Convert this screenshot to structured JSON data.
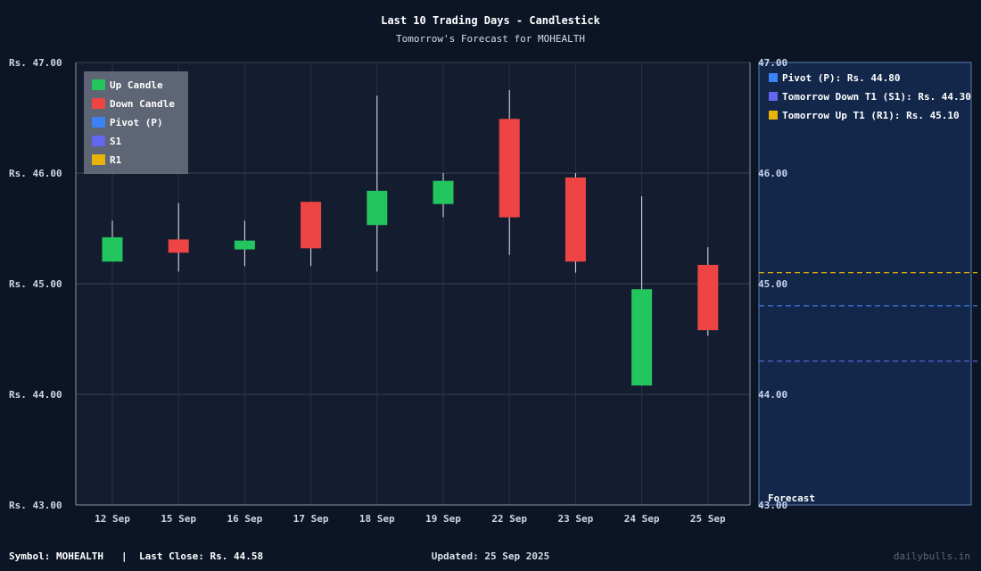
{
  "chart_data": {
    "type": "candlestick",
    "title": "Last 10 Trading Days - Candlestick",
    "subtitle": "Tomorrow's Forecast for MOHEALTH",
    "ylim": [
      43,
      47
    ],
    "y_ticks": [
      "Rs. 47.00",
      "Rs. 46.00",
      "Rs. 45.00",
      "Rs. 44.00",
      "Rs. 43.00"
    ],
    "right_ticks": [
      "47.00",
      "46.00",
      "45.00",
      "44.00",
      "43.00"
    ],
    "y_tick_values": [
      47,
      46,
      45,
      44,
      43
    ],
    "grid": true,
    "categories": [
      "12 Sep",
      "15 Sep",
      "16 Sep",
      "17 Sep",
      "18 Sep",
      "19 Sep",
      "22 Sep",
      "23 Sep",
      "24 Sep",
      "25 Sep"
    ],
    "candles": [
      {
        "date": "12 Sep",
        "open": 45.2,
        "close": 45.42,
        "high": 45.57,
        "low": 45.2
      },
      {
        "date": "15 Sep",
        "open": 45.4,
        "close": 45.28,
        "high": 45.73,
        "low": 45.11
      },
      {
        "date": "16 Sep",
        "open": 45.31,
        "close": 45.39,
        "high": 45.57,
        "low": 45.16
      },
      {
        "date": "17 Sep",
        "open": 45.74,
        "close": 45.32,
        "high": 45.74,
        "low": 45.16
      },
      {
        "date": "18 Sep",
        "open": 45.53,
        "close": 45.84,
        "high": 46.7,
        "low": 45.11
      },
      {
        "date": "19 Sep",
        "open": 45.72,
        "close": 45.93,
        "high": 46.0,
        "low": 45.6
      },
      {
        "date": "22 Sep",
        "open": 46.49,
        "close": 45.6,
        "high": 46.75,
        "low": 45.26
      },
      {
        "date": "23 Sep",
        "open": 45.96,
        "close": 45.2,
        "high": 46.0,
        "low": 45.1
      },
      {
        "date": "24 Sep",
        "open": 44.08,
        "close": 44.95,
        "high": 45.79,
        "low": 44.08
      },
      {
        "date": "25 Sep",
        "open": 45.17,
        "close": 44.58,
        "high": 45.33,
        "low": 44.53
      }
    ],
    "legend": [
      "Up Candle",
      "Down Candle",
      "Pivot (P)",
      "S1",
      "R1"
    ],
    "legend_placement": "top-left",
    "forecast": {
      "label": "Forecast",
      "levels": [
        {
          "key": "P",
          "label": "Pivot (P): Rs. 44.80",
          "value": 44.8,
          "color": "#3b82f6"
        },
        {
          "key": "S1",
          "label": "Tomorrow Down T1 (S1): Rs. 44.30",
          "value": 44.3,
          "color": "#6366f1"
        },
        {
          "key": "R1",
          "label": "Tomorrow Up T1 (R1): Rs. 45.10",
          "value": 45.1,
          "color": "#eab308"
        }
      ]
    },
    "colors": {
      "up": "#22c55e",
      "down": "#ef4444",
      "pivot": "#3b82f6",
      "s1": "#6366f1",
      "r1": "#eab308"
    }
  },
  "footer": {
    "symbol": "Symbol: MOHEALTH",
    "separator": "|",
    "last_close": "Last Close: Rs. 44.58",
    "updated": "Updated: 25 Sep 2025",
    "brand": "dailybulls.in"
  }
}
